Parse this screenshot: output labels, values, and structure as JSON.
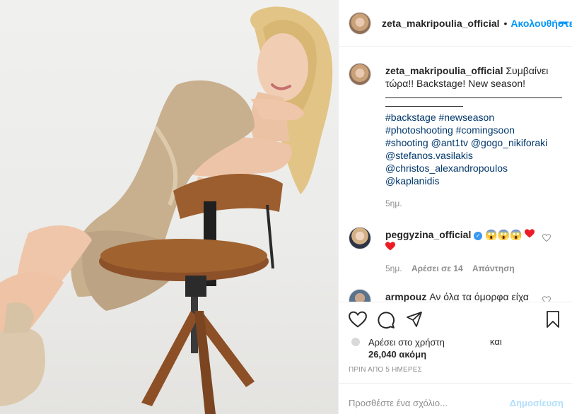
{
  "post": {
    "username": "zeta_makripoulia_official",
    "follow_label": "Ακολουθήστε",
    "more_label": "•••",
    "dot": "•"
  },
  "caption": {
    "username": "zeta_makripoulia_official",
    "text": "Συμβαίνει τώρα!! Backstage! New season!",
    "hashtags_line1": "#backstage #newseason",
    "hashtags_line2": "#photoshooting #comingsoon",
    "hashtags_line3": "#shooting @ant1tv @gogo_nikiforaki",
    "hashtags_line4": "@stefanos.vasilakis",
    "hashtags_line5": "@christos_alexandropoulos",
    "hashtags_line6": "@kaplanidis",
    "time": "5ημ."
  },
  "comments": [
    {
      "username": "peggyzina_official",
      "emojis": "😱😱😱",
      "time": "5ημ.",
      "likes": "Αρέσει σε 14",
      "reply": "Απάντηση"
    },
    {
      "username": "armpouz",
      "text": "Αν όλα τα όμορφα είχα"
    }
  ],
  "likes": {
    "prefix": "Αρέσει στο χρήστη",
    "and": "και",
    "count": "26,040 ακόμη"
  },
  "date": "ΠΡΙΝ ΑΠΟ 5 ΗΜΕΡΕΣ",
  "add_comment": {
    "placeholder": "Προσθέστε ένα σχόλιο...",
    "post_label": "Δημοσίευση"
  },
  "colors": {
    "link": "#00376b",
    "accent": "#0095f6",
    "heart": "#ed4956",
    "verified": "#3897f0"
  }
}
